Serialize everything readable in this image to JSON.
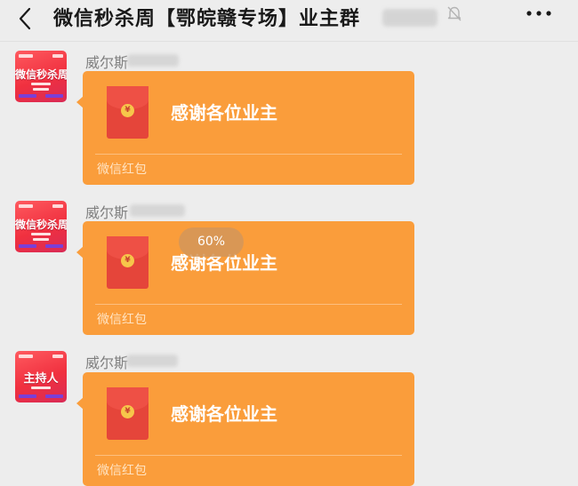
{
  "header": {
    "title": "微信秒杀周【鄂皖赣专场】业主群",
    "title_suffix_blurred": "( )",
    "icons": {
      "back": "chevron-left-icon",
      "mute": "bell-off-icon",
      "more": "more-dots-icon"
    }
  },
  "messages": [
    {
      "sender": "威尔斯",
      "avatar": {
        "text": "微信秒杀周",
        "color": "#F0303F"
      },
      "red_packet": {
        "greeting": "感谢各位业主",
        "label": "微信红包",
        "color": "#FA9D3B"
      }
    },
    {
      "sender": "威尔斯",
      "avatar": {
        "text": "微信秒杀周",
        "color": "#F0303F"
      },
      "red_packet": {
        "greeting": "感谢各位业主",
        "label": "微信红包",
        "color": "#FA9D3B"
      }
    },
    {
      "sender": "威尔斯",
      "avatar": {
        "text": "主持人",
        "color": "#F0303F"
      },
      "red_packet": {
        "greeting": "感谢各位业主",
        "label": "微信红包",
        "color": "#FA9D3B"
      }
    }
  ],
  "progress": {
    "text": "60%",
    "value": 0.6
  },
  "colors": {
    "background": "#EDEDED",
    "red_packet": "#FA9D3B",
    "envelope": "#E5453A"
  }
}
